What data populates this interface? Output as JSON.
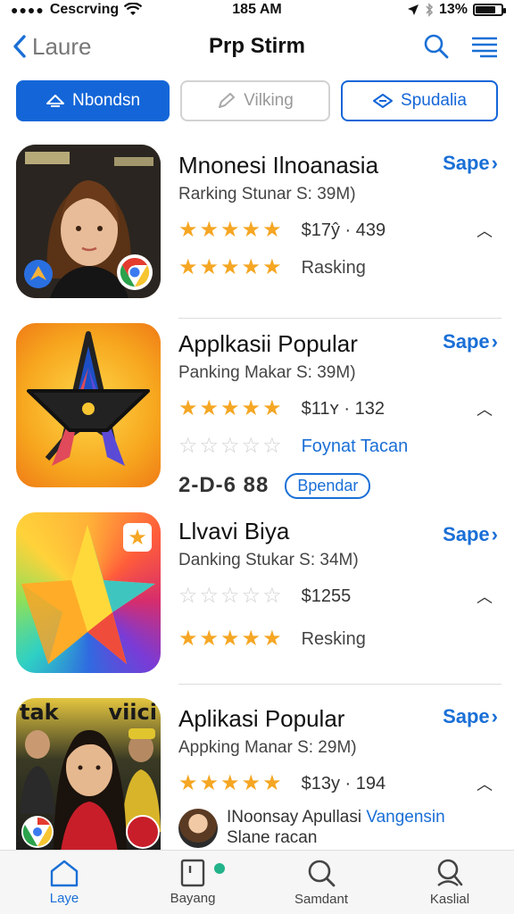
{
  "status_bar": {
    "carrier": "Cescrving",
    "time": "185 AM",
    "battery": "13%"
  },
  "nav": {
    "back_label": "Laure",
    "title": "Prp Stirm"
  },
  "pills": [
    {
      "label": "Nbondsn"
    },
    {
      "label": "Vilking"
    },
    {
      "label": "Spudalia"
    }
  ],
  "apps": [
    {
      "title": "Mnonesi Ilnoanasia",
      "subtitle": "Rarking Stunar S: 39M)",
      "get_label": "Sape",
      "price": "$17ŷ · 439",
      "rating": 5,
      "second_rating": 5,
      "second_label": "Rasking"
    },
    {
      "title": "Applkasii Popular",
      "subtitle": "Panking Makar S: 39M)",
      "get_label": "Sape",
      "price": "$11ʏ · 132",
      "rating": 5,
      "second_rating": 0,
      "second_label": "Foynat Tacan",
      "big_number": "2-D-6 88",
      "tag": "Bpendar"
    },
    {
      "title": "Llvavi Biya",
      "subtitle": "Danking Stukar S: 34M)",
      "get_label": "Sape",
      "price": "$1255",
      "rating": 0,
      "second_rating": 5,
      "second_label": "Resking"
    },
    {
      "title": "Aplikasi Popular",
      "subtitle": "Appking Manar S: 29M)",
      "get_label": "Sape",
      "price": "$13y · 194",
      "rating": 5,
      "profile_name": "INoonsay Apullasi",
      "profile_link": "Vangensin",
      "profile_sub": "Slane racan"
    }
  ],
  "tabs": [
    {
      "label": "Laye"
    },
    {
      "label": "Bayang"
    },
    {
      "label": "Samdant"
    },
    {
      "label": "Kaslial"
    }
  ],
  "colors": {
    "accent": "#1a6fd6",
    "star": "#f5a623",
    "badge_dot": "#22b38a"
  }
}
